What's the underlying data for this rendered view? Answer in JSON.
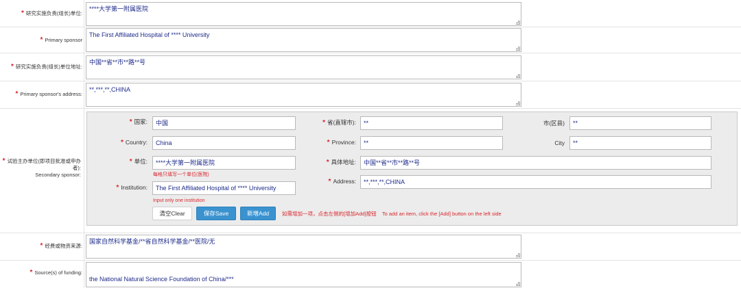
{
  "primary_sponsor_cn": {
    "label": "研究实施负责(组长)单位:",
    "value": "****大学第一附属医院"
  },
  "primary_sponsor_en": {
    "label": "Primary sponsor",
    "value": "The First Affiliated Hospital of **** University"
  },
  "primary_sponsor_address_cn": {
    "label": "研究实施负责(组长)单位地址:",
    "value": "中国**省**市**路**号"
  },
  "primary_sponsor_address_en": {
    "label": "Primary sponsor's address:",
    "value": "**,***,**,CHINA"
  },
  "secondary_sponsor": {
    "label_cn": "试验主办单位(即项目批准或申办者):",
    "label_en": "Secondary sponsor:",
    "country_cn": {
      "label": "国家:",
      "value": "中国"
    },
    "country_en": {
      "label": "Country:",
      "value": "China"
    },
    "institution_cn": {
      "label": "单位:",
      "value": "****大学第一附属医院",
      "hint": "每格只填写一个单位(医院)"
    },
    "institution_en": {
      "label": "Institution:",
      "value": "The First Affiliated Hospital of **** University",
      "hint": "Input only one institution"
    },
    "province_cn": {
      "label": "省(直辖市):",
      "value": "**"
    },
    "province_en": {
      "label": "Province:",
      "value": "**"
    },
    "address_cn": {
      "label": "具体地址:",
      "value": "中国**省**市**路**号"
    },
    "address_en": {
      "label": "Address:",
      "value": "**,***,**,CHINA"
    },
    "city_cn": {
      "label": "市(区县)",
      "value": "**"
    },
    "city_en": {
      "label": "City",
      "value": "**"
    },
    "buttons": {
      "clear": "清空Clear",
      "save": "保存Save",
      "add": "新增Add"
    },
    "add_hint": "如需增加一项，点击左侧的[增加Add]按钮    To add an item, click the [Add] button on the left side"
  },
  "funding_cn": {
    "label": "经费或物资来源:",
    "value": "国家自然科学基金/**省自然科学基金/**医院/无"
  },
  "funding_en": {
    "label": "Source(s) of funding:",
    "value": "the National Natural Science Foundation of China/***"
  },
  "colors": {
    "required_star": "#d9262c",
    "value_text": "#1e2b8a",
    "button_blue": "#3a92cf"
  }
}
